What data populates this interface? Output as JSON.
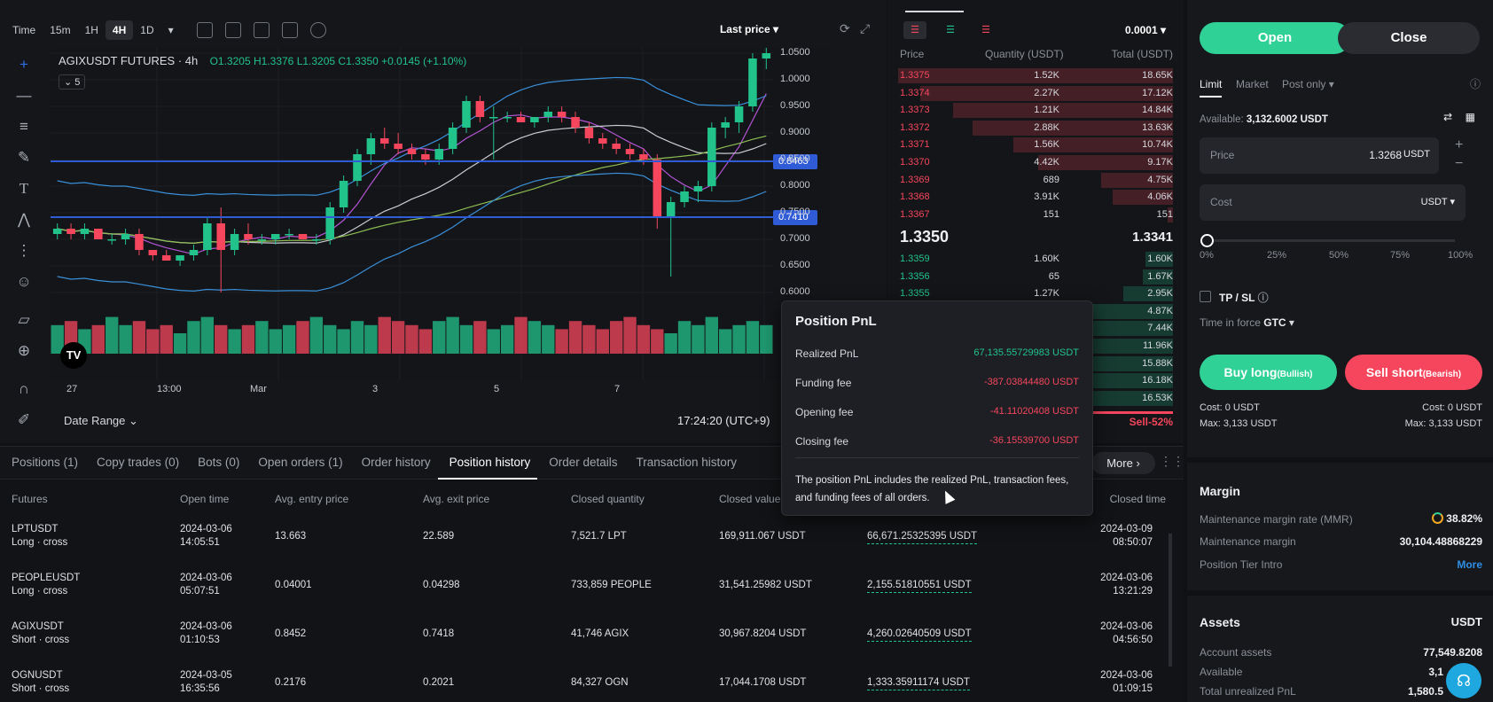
{
  "chart": {
    "timeframes": [
      "Time",
      "15m",
      "1H",
      "4H",
      "1D"
    ],
    "active_tf": "4H",
    "last_price_label": "Last price",
    "symbol": "AGIXUSDT FUTURES · 4h",
    "ohlc": {
      "o": "O1.3205",
      "h": "H1.3376",
      "l": "L1.3205",
      "c": "C1.3350",
      "chg": "+0.0145 (+1.10%)"
    },
    "indicator_count": "5",
    "price_labels": [
      "1.0500",
      "1.0000",
      "0.9500",
      "0.9000",
      "0.8500",
      "0.8000",
      "0.7500",
      "0.7000",
      "0.6500",
      "0.6000"
    ],
    "line_tags": [
      "0.8463",
      "0.7410"
    ],
    "x_labels": [
      "27",
      "13:00",
      "Mar",
      "3",
      "5",
      "7"
    ],
    "date_range": "Date Range",
    "clock": "17:24:20 (UTC+9)",
    "logo": "TV"
  },
  "chart_data": {
    "type": "candlestick",
    "ylim": [
      0.56,
      1.06
    ],
    "candles": [
      [
        0.71,
        0.73,
        0.7,
        0.72
      ],
      [
        0.72,
        0.73,
        0.7,
        0.71
      ],
      [
        0.71,
        0.73,
        0.7,
        0.72
      ],
      [
        0.72,
        0.72,
        0.7,
        0.7
      ],
      [
        0.7,
        0.71,
        0.69,
        0.7
      ],
      [
        0.7,
        0.72,
        0.69,
        0.71
      ],
      [
        0.71,
        0.72,
        0.67,
        0.68
      ],
      [
        0.68,
        0.68,
        0.66,
        0.67
      ],
      [
        0.67,
        0.68,
        0.66,
        0.66
      ],
      [
        0.66,
        0.67,
        0.65,
        0.67
      ],
      [
        0.67,
        0.69,
        0.66,
        0.68
      ],
      [
        0.68,
        0.74,
        0.67,
        0.73
      ],
      [
        0.73,
        0.76,
        0.6,
        0.68
      ],
      [
        0.68,
        0.72,
        0.67,
        0.71
      ],
      [
        0.71,
        0.73,
        0.69,
        0.7
      ],
      [
        0.7,
        0.71,
        0.69,
        0.7
      ],
      [
        0.7,
        0.71,
        0.69,
        0.71
      ],
      [
        0.71,
        0.72,
        0.7,
        0.71
      ],
      [
        0.71,
        0.71,
        0.7,
        0.7
      ],
      [
        0.7,
        0.71,
        0.69,
        0.7
      ],
      [
        0.7,
        0.77,
        0.69,
        0.76
      ],
      [
        0.76,
        0.82,
        0.75,
        0.81
      ],
      [
        0.81,
        0.87,
        0.8,
        0.86
      ],
      [
        0.86,
        0.9,
        0.84,
        0.89
      ],
      [
        0.89,
        0.91,
        0.87,
        0.88
      ],
      [
        0.88,
        0.9,
        0.86,
        0.87
      ],
      [
        0.87,
        0.88,
        0.85,
        0.86
      ],
      [
        0.86,
        0.87,
        0.84,
        0.85
      ],
      [
        0.85,
        0.88,
        0.84,
        0.87
      ],
      [
        0.87,
        0.92,
        0.86,
        0.91
      ],
      [
        0.91,
        0.97,
        0.9,
        0.96
      ],
      [
        0.96,
        0.97,
        0.92,
        0.93
      ],
      [
        0.93,
        0.95,
        0.85,
        0.93
      ],
      [
        0.93,
        0.94,
        0.92,
        0.93
      ],
      [
        0.93,
        0.94,
        0.92,
        0.92
      ],
      [
        0.92,
        0.93,
        0.91,
        0.93
      ],
      [
        0.93,
        0.95,
        0.92,
        0.94
      ],
      [
        0.94,
        0.95,
        0.92,
        0.93
      ],
      [
        0.93,
        0.94,
        0.9,
        0.91
      ],
      [
        0.91,
        0.92,
        0.88,
        0.89
      ],
      [
        0.89,
        0.9,
        0.87,
        0.88
      ],
      [
        0.88,
        0.89,
        0.86,
        0.87
      ],
      [
        0.87,
        0.88,
        0.85,
        0.86
      ],
      [
        0.86,
        0.87,
        0.84,
        0.85
      ],
      [
        0.85,
        0.86,
        0.72,
        0.74
      ],
      [
        0.74,
        0.78,
        0.63,
        0.77
      ],
      [
        0.77,
        0.8,
        0.76,
        0.79
      ],
      [
        0.79,
        0.81,
        0.77,
        0.8
      ],
      [
        0.8,
        0.92,
        0.79,
        0.91
      ],
      [
        0.91,
        0.93,
        0.89,
        0.92
      ],
      [
        0.92,
        0.96,
        0.9,
        0.95
      ],
      [
        0.95,
        1.05,
        0.94,
        1.04
      ],
      [
        1.04,
        1.06,
        1.02,
        1.05
      ]
    ],
    "volume": [
      0.7,
      0.8,
      0.6,
      0.7,
      0.9,
      0.7,
      0.8,
      0.6,
      0.7,
      0.5,
      0.8,
      0.9,
      0.7,
      0.6,
      0.7,
      0.8,
      0.6,
      0.7,
      0.8,
      0.9,
      0.7,
      0.6,
      0.8,
      0.7,
      0.9,
      0.8,
      0.7,
      0.6,
      0.8,
      0.9,
      0.7,
      0.8,
      0.6,
      0.7,
      0.9,
      0.8,
      0.7,
      0.6,
      0.8,
      0.7,
      0.6,
      0.8,
      0.9,
      0.7,
      0.6,
      0.5,
      0.8,
      0.7,
      0.9,
      0.6,
      0.7,
      0.8,
      0.7
    ],
    "hlines": [
      0.8463,
      0.741
    ]
  },
  "orderbook": {
    "tabs": [
      "book-both",
      "book-buy",
      "book-sell"
    ],
    "precision": "0.0001",
    "headers": [
      "Price",
      "Quantity (USDT)",
      "Total (USDT)"
    ],
    "asks": [
      [
        "1.3375",
        "1.52K",
        "18.65K",
        1.0
      ],
      [
        "1.3374",
        "2.27K",
        "17.12K",
        0.92
      ],
      [
        "1.3373",
        "1.21K",
        "14.84K",
        0.8
      ],
      [
        "1.3372",
        "2.88K",
        "13.63K",
        0.73
      ],
      [
        "1.3371",
        "1.56K",
        "10.74K",
        0.58
      ],
      [
        "1.3370",
        "4.42K",
        "9.17K",
        0.49
      ],
      [
        "1.3369",
        "689",
        "4.75K",
        0.26
      ],
      [
        "1.3368",
        "3.91K",
        "4.06K",
        0.22
      ],
      [
        "1.3367",
        "151",
        "151",
        0.02
      ]
    ],
    "mid_price": "1.3350",
    "mark_price": "1.3341",
    "bids": [
      [
        "1.3359",
        "1.60K",
        "1.60K",
        0.1
      ],
      [
        "1.3356",
        "65",
        "1.67K",
        0.11
      ],
      [
        "1.3355",
        "1.27K",
        "2.95K",
        0.18
      ],
      [
        "",
        "",
        "4.87K",
        0.3
      ],
      [
        "",
        "",
        "7.44K",
        0.46
      ],
      [
        "",
        "",
        "11.96K",
        0.73
      ],
      [
        "",
        "",
        "15.88K",
        0.98
      ],
      [
        "",
        "",
        "16.18K",
        1.0
      ],
      [
        "",
        "",
        "16.53K",
        1.0
      ]
    ],
    "ratio_label": "Sell-52%"
  },
  "tabs": [
    "Positions (1)",
    "Copy trades (0)",
    "Bots (0)",
    "Open orders (1)",
    "Order history",
    "Position history",
    "Order details",
    "Transaction history"
  ],
  "active_tab": "Position history",
  "more_label": "More",
  "table": {
    "headers": [
      "Futures",
      "Open time",
      "Avg. entry price",
      "Avg. exit price",
      "Closed quantity",
      "Closed value",
      "Position PnL",
      "Closed time"
    ],
    "rows": [
      {
        "sym": "LPTUSDT",
        "side": "Long · cross",
        "side_color": "green",
        "open": [
          "2024-03-06",
          "14:05:51"
        ],
        "entry": "13.663",
        "exit": "22.589",
        "qty": "7,521.7 LPT",
        "value": "169,911.067 USDT",
        "pnl": "66,671.25325395 USDT",
        "close": [
          "2024-03-09",
          "08:50:07"
        ]
      },
      {
        "sym": "PEOPLEUSDT",
        "side": "Long · cross",
        "side_color": "green",
        "open": [
          "2024-03-06",
          "05:07:51"
        ],
        "entry": "0.04001",
        "exit": "0.04298",
        "qty": "733,859 PEOPLE",
        "value": "31,541.25982 USDT",
        "pnl": "2,155.51810551 USDT",
        "close": [
          "2024-03-06",
          "13:21:29"
        ]
      },
      {
        "sym": "AGIXUSDT",
        "side": "Short · cross",
        "side_color": "red",
        "open": [
          "2024-03-06",
          "01:10:53"
        ],
        "entry": "0.8452",
        "exit": "0.7418",
        "qty": "41,746 AGIX",
        "value": "30,967.8204 USDT",
        "pnl": "4,260.02640509 USDT",
        "close": [
          "2024-03-06",
          "04:56:50"
        ]
      },
      {
        "sym": "OGNUSDT",
        "side": "Short · cross",
        "side_color": "red",
        "open": [
          "2024-03-05",
          "16:35:56"
        ],
        "entry": "0.2176",
        "exit": "0.2021",
        "qty": "84,327 OGN",
        "value": "17,044.1708 USDT",
        "pnl": "1,333.35911174 USDT",
        "close": [
          "2024-03-06",
          "01:09:15"
        ]
      }
    ]
  },
  "tooltip": {
    "title": "Position PnL",
    "rows": [
      [
        "Realized PnL",
        "67,135.55729983 USDT",
        "green"
      ],
      [
        "Funding fee",
        "-387.03844480 USDT",
        "red"
      ],
      [
        "Opening fee",
        "-41.11020408 USDT",
        "red"
      ],
      [
        "Closing fee",
        "-36.15539700 USDT",
        "red"
      ]
    ],
    "note": "The position PnL includes the realized PnL, transaction fees, and funding fees of all orders."
  },
  "trade": {
    "open": "Open",
    "close": "Close",
    "order_types": [
      "Limit",
      "Market",
      "Post only"
    ],
    "available_label": "Available:",
    "available_value": "3,132.6002 USDT",
    "price_label": "Price",
    "price_value": "1.3268",
    "price_unit": "USDT",
    "cost_label": "Cost",
    "cost_unit": "USDT",
    "slider": [
      "0%",
      "25%",
      "50%",
      "75%",
      "100%"
    ],
    "slider_fraction": 0,
    "tpsl": "TP / SL",
    "tif_label": "Time in force",
    "tif_value": "GTC",
    "buy": "Buy long",
    "buy_sub": "(Bullish)",
    "sell": "Sell short",
    "sell_sub": "(Bearish)",
    "cost_left": "Cost: 0 USDT",
    "max_left": "Max: 3,133 USDT",
    "cost_right": "Cost: 0 USDT",
    "max_right": "Max: 3,133 USDT",
    "margin_title": "Margin",
    "mmr_label": "Maintenance margin rate (MMR)",
    "mmr_value": "38.82%",
    "mm_label": "Maintenance margin",
    "mm_value": "30,104.48868229",
    "tier_label": "Position Tier Intro",
    "tier_link": "More",
    "assets_title": "Assets",
    "assets_unit": "USDT",
    "acc_label": "Account assets",
    "acc_value": "77,549.8208",
    "avail_label": "Available",
    "avail_value": "3,1",
    "upnl_label": "Total unrealized PnL",
    "upnl_value": "1,580.5"
  },
  "colors": {
    "green": "#21c38b",
    "red": "#f6465d",
    "blue": "#2f5bd6",
    "teal": "#2fd197"
  }
}
